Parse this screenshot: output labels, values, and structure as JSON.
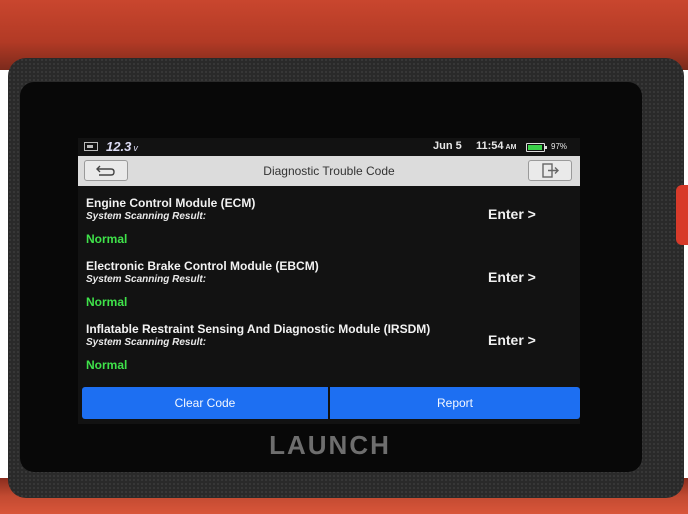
{
  "status": {
    "voltage": "12.3",
    "voltage_unit": "v",
    "date": "Jun 5",
    "time": "11:54",
    "ampm": "AM",
    "battery_pct": "97%"
  },
  "header": {
    "title": "Diagnostic Trouble Code"
  },
  "modules": [
    {
      "name": "Engine Control Module (ECM)",
      "result_label": "System Scanning Result:",
      "status": "Normal",
      "action": "Enter >"
    },
    {
      "name": "Electronic Brake Control Module (EBCM)",
      "result_label": "System Scanning Result:",
      "status": "Normal",
      "action": "Enter >"
    },
    {
      "name": "Inflatable Restraint Sensing And Diagnostic Module (IRSDM)",
      "result_label": "System Scanning Result:",
      "status": "Normal",
      "action": "Enter >"
    }
  ],
  "actions": {
    "clear_code": "Clear Code",
    "report": "Report"
  },
  "device": {
    "brand": "LAUNCH"
  },
  "colors": {
    "status_normal": "#3fe24a",
    "button_blue": "#1d6ff2",
    "device_orange": "#c24a31"
  }
}
